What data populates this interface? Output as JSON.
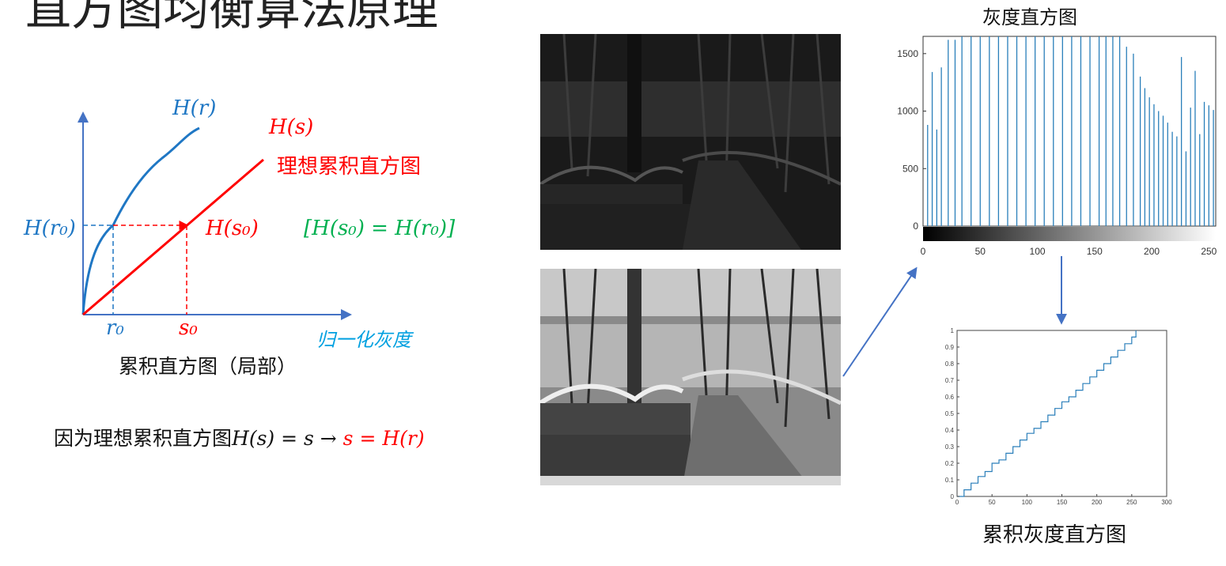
{
  "slide": {
    "title": "直方图均衡算法原理"
  },
  "diagram": {
    "curve_label_hr": "H(r)",
    "line_label_hs": "H(s)",
    "ideal_label": "理想累积直方图",
    "label_hr0": "H(r₀)",
    "label_hs0": "H(s₀)",
    "equal_label": "[H(s₀) = H(r₀)]",
    "tick_r0": "r₀",
    "tick_s0": "s₀",
    "xaxis_label": "归一化灰度",
    "caption": "累积直方图（局部）",
    "colors": {
      "blue": "#1f77c4",
      "red": "#ff0000",
      "green": "#00b050",
      "cyan": "#00a0e0"
    }
  },
  "formula": {
    "prefix": "因为理想累积直方图",
    "part1": "H(s) = s → ",
    "part2": "s = H(r)"
  },
  "histogram": {
    "title": "灰度直方图",
    "yticks": [
      "1500",
      "1000",
      "500",
      "0"
    ],
    "xticks": [
      "0",
      "50",
      "100",
      "150",
      "200",
      "250"
    ],
    "bar_color": "#2a7fba"
  },
  "cumulative": {
    "caption": "累积灰度直方图",
    "yticks": [
      "1",
      "0.9",
      "0.8",
      "0.7",
      "0.6",
      "0.5",
      "0.4",
      "0.3",
      "0.2",
      "0.1",
      "0"
    ],
    "xticks": [
      "0",
      "50",
      "100",
      "150",
      "200",
      "250",
      "300"
    ]
  },
  "chart_data": [
    {
      "type": "bar",
      "title": "灰度直方图",
      "xlim": [
        0,
        256
      ],
      "ylim": [
        0,
        1650
      ],
      "x": [
        4,
        8,
        12,
        16,
        22,
        28,
        34,
        42,
        50,
        58,
        66,
        74,
        82,
        90,
        98,
        106,
        114,
        122,
        130,
        138,
        146,
        154,
        160,
        166,
        172,
        178,
        184,
        190,
        194,
        198,
        202,
        206,
        210,
        214,
        218,
        222,
        226,
        230,
        234,
        238,
        242,
        246,
        250,
        254
      ],
      "values": [
        880,
        1340,
        840,
        1380,
        1620,
        1620,
        1650,
        1650,
        1650,
        1650,
        1650,
        1650,
        1650,
        1650,
        1650,
        1650,
        1650,
        1650,
        1650,
        1650,
        1650,
        1650,
        1650,
        1650,
        1650,
        1560,
        1500,
        1300,
        1200,
        1120,
        1060,
        1000,
        960,
        900,
        820,
        780,
        1470,
        650,
        1030,
        1350,
        800,
        1080,
        1050,
        1010
      ]
    },
    {
      "type": "line",
      "title": "累积灰度直方图",
      "xlim": [
        0,
        300
      ],
      "ylim": [
        0,
        1
      ],
      "x": [
        0,
        10,
        20,
        30,
        40,
        50,
        60,
        70,
        80,
        90,
        100,
        110,
        120,
        130,
        140,
        150,
        160,
        170,
        180,
        190,
        200,
        210,
        220,
        230,
        240,
        250,
        256
      ],
      "y": [
        0,
        0.04,
        0.08,
        0.12,
        0.15,
        0.2,
        0.22,
        0.26,
        0.3,
        0.34,
        0.38,
        0.41,
        0.45,
        0.49,
        0.53,
        0.57,
        0.6,
        0.64,
        0.68,
        0.72,
        0.76,
        0.8,
        0.84,
        0.88,
        0.92,
        0.96,
        1.0
      ]
    }
  ]
}
